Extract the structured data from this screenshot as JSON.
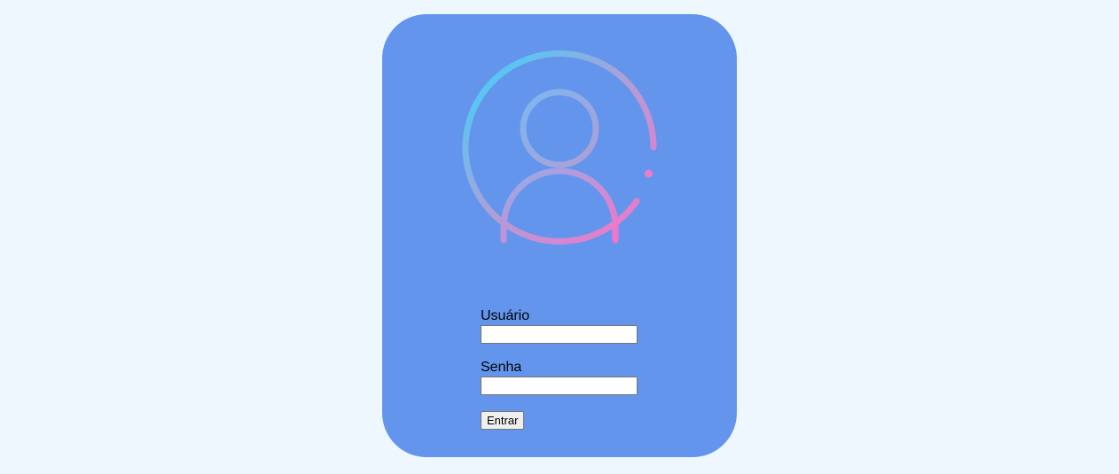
{
  "avatar": {
    "icon": "user-circle-icon",
    "gradient_colors": [
      "#35d6fe",
      "#b09ed6",
      "#f872c8"
    ]
  },
  "login_form": {
    "username_label": "Usuário",
    "username_value": "",
    "password_label": "Senha",
    "password_value": "",
    "submit_label": "Entrar"
  },
  "colors": {
    "page_background": "#eff7fe",
    "card_background": "#6495ed"
  }
}
